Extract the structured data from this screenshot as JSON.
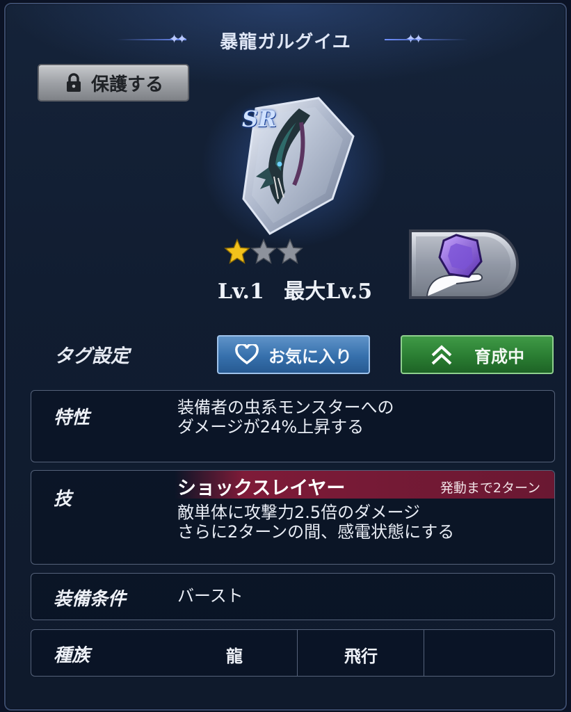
{
  "title": "暴龍ガルグイユ",
  "protect_button": "保護する",
  "rarity": "SR",
  "stars": {
    "filled": 1,
    "total": 3
  },
  "level": {
    "current": "Lv.1",
    "max": "最大Lv.5"
  },
  "tags": {
    "label": "タグ設定",
    "favorite": "お気に入り",
    "training": "育成中"
  },
  "trait": {
    "label": "特性",
    "lines": [
      "装備者の虫系モンスターへの",
      "ダメージが24%上昇する"
    ]
  },
  "skill": {
    "label": "技",
    "name": "ショックスレイヤー",
    "cooldown": "発動まで2ターン",
    "lines": [
      "敵単体に攻撃力2.5倍のダメージ",
      "さらに2ターンの間、感電状態にする"
    ]
  },
  "equip_condition": {
    "label": "装備条件",
    "value": "バースト"
  },
  "race": {
    "label": "種族",
    "values": [
      "龍",
      "飛行",
      ""
    ]
  },
  "colors": {
    "background": "#111d31",
    "favorite_button": "#3670ac",
    "training_button": "#2a7d32",
    "skill_bar": "#7e1b38"
  }
}
